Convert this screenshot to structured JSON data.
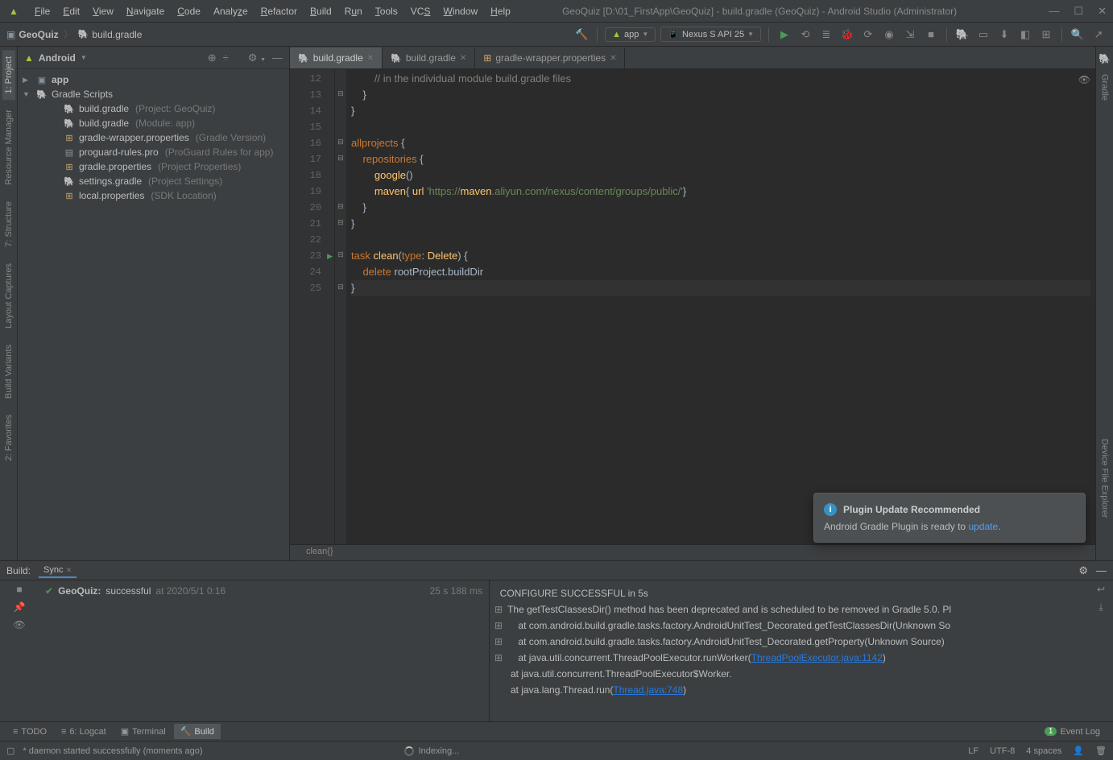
{
  "title": "GeoQuiz [D:\\01_FirstApp\\GeoQuiz] - build.gradle (GeoQuiz) - Android Studio (Administrator)",
  "menu": [
    "File",
    "Edit",
    "View",
    "Navigate",
    "Code",
    "Analyze",
    "Refactor",
    "Build",
    "Run",
    "Tools",
    "VCS",
    "Window",
    "Help"
  ],
  "breadcrumb": {
    "project": "GeoQuiz",
    "file": "build.gradle"
  },
  "toolbar": {
    "run_app": "app",
    "device": "Nexus S API 25"
  },
  "left_tabs": [
    "1: Project",
    "Resource Manager",
    "7: Structure",
    "Layout Captures",
    "Build Variants",
    "2: Favorites"
  ],
  "right_tabs": [
    "Gradle",
    "Device File Explorer"
  ],
  "project_panel": {
    "mode": "Android",
    "app": "app",
    "scripts_label": "Gradle Scripts",
    "items": [
      {
        "label": "build.gradle",
        "hint": "(Project: GeoQuiz)",
        "icon": "elephant"
      },
      {
        "label": "build.gradle",
        "hint": "(Module: app)",
        "icon": "elephant"
      },
      {
        "label": "gradle-wrapper.properties",
        "hint": "(Gradle Version)",
        "icon": "props"
      },
      {
        "label": "proguard-rules.pro",
        "hint": "(ProGuard Rules for app)",
        "icon": "file"
      },
      {
        "label": "gradle.properties",
        "hint": "(Project Properties)",
        "icon": "props"
      },
      {
        "label": "settings.gradle",
        "hint": "(Project Settings)",
        "icon": "elephant"
      },
      {
        "label": "local.properties",
        "hint": "(SDK Location)",
        "icon": "props"
      }
    ]
  },
  "editor": {
    "tabs": [
      {
        "label": "build.gradle",
        "icon": "elephant",
        "active": true
      },
      {
        "label": "build.gradle",
        "icon": "elephant",
        "active": false
      },
      {
        "label": "gradle-wrapper.properties",
        "icon": "props",
        "active": false
      }
    ],
    "first_line": 12,
    "crumb": "clean{}",
    "lines": [
      "        // in the individual module build.gradle files",
      "    }",
      "}",
      "",
      "allprojects {",
      "    repositories {",
      "        google()",
      "        maven{ url 'https://maven.aliyun.com/nexus/content/groups/public/'}",
      "    }",
      "}",
      "",
      "task clean(type: Delete) {",
      "    delete rootProject.buildDir",
      "}"
    ]
  },
  "build": {
    "title": "Build:",
    "tab_label": "Sync",
    "status_project": "GeoQuiz:",
    "status_text": "successful",
    "status_at": "at 2020/5/1 0:16",
    "duration": "25 s 188 ms",
    "log": [
      "CONFIGURE SUCCESSFUL in 5s",
      "The getTestClassesDir() method has been deprecated and is scheduled to be removed in Gradle 5.0. Pl",
      "    at com.android.build.gradle.tasks.factory.AndroidUnitTest_Decorated.getTestClassesDir(Unknown So",
      "    at com.android.build.gradle.tasks.factory.AndroidUnitTest_Decorated.getProperty(Unknown Source)",
      "    at java.util.concurrent.ThreadPoolExecutor.runWorker(ThreadPoolExecutor.java:1142)",
      "    at java.util.concurrent.ThreadPoolExecutor$Worker.",
      "    at java.lang.Thread.run(Thread.java:748)"
    ],
    "link1": "ThreadPoolExecutor.java:1142",
    "link2": "Thread.java:748"
  },
  "tool_buttons": [
    {
      "icon": "≡",
      "label": "TODO"
    },
    {
      "icon": "≡",
      "label": "6: Logcat"
    },
    {
      "icon": "▣",
      "label": "Terminal"
    },
    {
      "icon": "🔨",
      "label": "Build",
      "active": true
    }
  ],
  "event_log": {
    "count": "1",
    "label": "Event Log"
  },
  "status": {
    "daemon": "* daemon started successfully (moments ago)",
    "indexing": "Indexing...",
    "lf": "LF",
    "enc": "UTF-8",
    "spaces": "4 spaces"
  },
  "notification": {
    "title": "Plugin Update Recommended",
    "body_pre": "Android Gradle Plugin is ready to ",
    "body_link": "update",
    "body_post": "."
  }
}
